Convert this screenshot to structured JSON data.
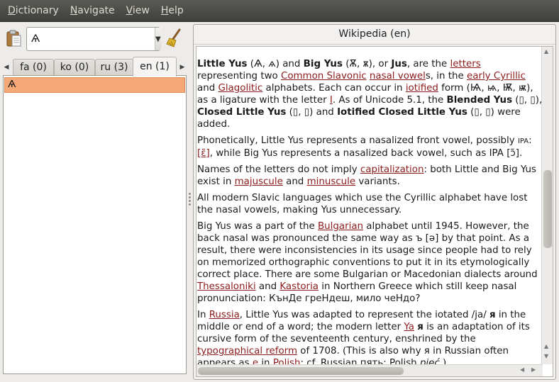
{
  "menu": {
    "items": [
      {
        "underline": "D",
        "rest": "ictionary"
      },
      {
        "underline": "N",
        "rest": "avigate"
      },
      {
        "underline": "V",
        "rest": "iew"
      },
      {
        "underline": "H",
        "rest": "elp"
      }
    ]
  },
  "search": {
    "value": "Ѧ",
    "dropdown_icon": "▼"
  },
  "icons": {
    "paste": "paste-icon",
    "clear": "broom-icon"
  },
  "tabs": {
    "scroll_left": "◀",
    "scroll_right": "▶",
    "items": [
      {
        "label": "fa (0)"
      },
      {
        "label": "ko (0)"
      },
      {
        "label": "ru (3)"
      },
      {
        "label": "en (1)"
      }
    ],
    "active_index": 3
  },
  "results": {
    "items": [
      {
        "label": "Ѧ"
      }
    ]
  },
  "article": {
    "title": "Wikipedia (en)",
    "p1": {
      "b1": "Little Yus",
      "t1": " (Ѧ, ѧ) and ",
      "b2": "Big Yus",
      "t2": " (Ѫ, ѫ), or ",
      "b3": "Jus",
      "t3": ", are the ",
      "l1": "letters",
      "t4": " representing two ",
      "l2": "Common Slavonic",
      "t5": " ",
      "l3": "nasal vowel",
      "t6": "s, in the ",
      "l4": "early Cyrillic",
      "t7": " and ",
      "l5": "Glagolitic",
      "t8": " alphabets.  Each can occur in ",
      "l6": "iotified",
      "t9": " form (Ѩ, ѩ, Ѭ, ѭ), as a ligature with the letter ",
      "l7": "І",
      "t10": ". As of Unicode 5.1, the ",
      "b4": "Blended Yus",
      "t11": " (▯, ▯), ",
      "b5": "Closed Little Yus",
      "t12": " (▯, ▯) and ",
      "b6": "Iotified Closed Little Yus",
      "t13": " (▯, ▯) were added."
    },
    "p2": {
      "t1": " Phonetically, Little Yus represents a nasalized front vowel, possibly ",
      "ipa": "IPA",
      "t2": ": ",
      "l1": "[ɛ̃]",
      "t3": ", while Big Yus represents a nasalized back vowel, such as IPA [ɔ̃]."
    },
    "p3": {
      "t1": "Names of the letters do not imply ",
      "l1": "capitalization",
      "t2": ": both Little and Big Yus exist in ",
      "l2": "majuscule",
      "t3": " and ",
      "l3": "minuscule",
      "t4": " variants."
    },
    "p4": {
      "t1": "All modern Slavic languages which use the Cyrillic alphabet have lost the nasal vowels, making Yus unnecessary."
    },
    "p5": {
      "t1": "Big Yus was a part of the ",
      "l1": "Bulgarian",
      "t2": " alphabet until 1945. However, the back nasal was pronounced the same way as ъ [ə] by that point. As a result, there were inconsistencies in its usage since people had to rely on memorized orthographic conventions to put it in its etymologically correct place. There are some Bulgarian or Macedonian dialects around ",
      "l2": "Thessaloniki",
      "t3": " and ",
      "l3": "Kastoria",
      "t4": " in Northern Greece which still keep nasal pronunciation: КънДе греНдеш, мило чеНдо?"
    },
    "p6": {
      "t1": "In ",
      "l1": "Russia",
      "t2": ", Little Yus was adapted to represent the iotated /ja/ ",
      "b1": "я",
      "t3": " in the middle or end of a word; the modern letter ",
      "l2": "Ya",
      "t4": " ",
      "b2": "я",
      "t5": " is an adaptation of its cursive form of the seventeenth century, enshrined by the ",
      "l3": "typographical reform",
      "t6": " of 1708. (This is also why я in Russian often appears as ",
      "l4": "e",
      "t7": " in ",
      "l5": "Polish",
      "t8": "; cf. Russian пять; Polish ",
      "i1": "pięć",
      "t9": ".)"
    }
  },
  "scroll": {
    "up": "▲",
    "down": "▼",
    "left": "◀",
    "right": "▶"
  }
}
